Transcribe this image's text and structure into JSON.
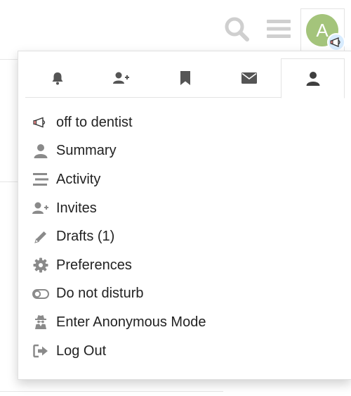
{
  "colors": {
    "icon_gray": "#9a9a9a",
    "icon_dark": "#4a4a4a",
    "avatar_bg": "#a4c47b",
    "status_bubble": "#d8ecff",
    "text": "#222222"
  },
  "header": {
    "avatar_letter": "A",
    "search_icon": "search-icon",
    "menu_icon": "hamburger-icon",
    "status_icon": "megaphone-icon"
  },
  "tabs": [
    {
      "name": "notifications",
      "icon": "bell-icon",
      "active": false
    },
    {
      "name": "invites",
      "icon": "user-plus-icon",
      "active": false
    },
    {
      "name": "bookmarks",
      "icon": "bookmark-icon",
      "active": false
    },
    {
      "name": "messages",
      "icon": "envelope-icon",
      "active": false
    },
    {
      "name": "profile",
      "icon": "user-icon",
      "active": true
    }
  ],
  "menu": {
    "status": "off to dentist",
    "summary": "Summary",
    "activity": "Activity",
    "invites": "Invites",
    "drafts": "Drafts (1)",
    "preferences": "Preferences",
    "dnd": "Do not disturb",
    "anonymous": "Enter Anonymous Mode",
    "logout": "Log Out"
  }
}
